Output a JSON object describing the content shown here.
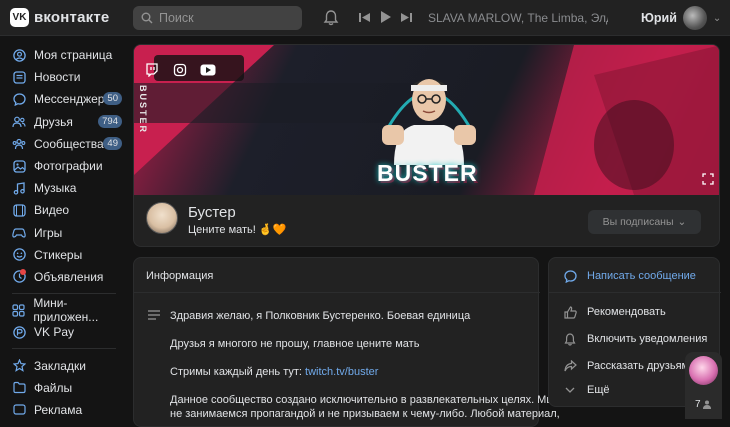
{
  "header": {
    "logo_mark": "VK",
    "logo_text": "вконтакте",
    "search_placeholder": "Поиск",
    "now_playing": "SLAVA MARLOW, The Limba, Элдже...",
    "user_name": "Юрий"
  },
  "sidebar": {
    "items": [
      {
        "label": "Моя страница",
        "icon": "user-circle-icon"
      },
      {
        "label": "Новости",
        "icon": "news-icon"
      },
      {
        "label": "Мессенджер",
        "icon": "messenger-icon",
        "badge": "50"
      },
      {
        "label": "Друзья",
        "icon": "friends-icon",
        "badge": "794"
      },
      {
        "label": "Сообщества",
        "icon": "communities-icon",
        "badge": "49"
      },
      {
        "label": "Фотографии",
        "icon": "photo-icon"
      },
      {
        "label": "Музыка",
        "icon": "music-icon"
      },
      {
        "label": "Видео",
        "icon": "video-icon"
      },
      {
        "label": "Игры",
        "icon": "games-icon"
      },
      {
        "label": "Стикеры",
        "icon": "stickers-icon"
      },
      {
        "label": "Объявления",
        "icon": "ads-icon"
      }
    ],
    "items2": [
      {
        "label": "Мини-приложен...",
        "icon": "mini-apps-icon"
      },
      {
        "label": "VK Pay",
        "icon": "vkpay-icon"
      }
    ],
    "items3": [
      {
        "label": "Закладки",
        "icon": "bookmarks-icon"
      },
      {
        "label": "Файлы",
        "icon": "files-icon"
      },
      {
        "label": "Реклама",
        "icon": "advert-icon"
      }
    ]
  },
  "cover": {
    "side_text": "BUSTER",
    "title": "BUSTER"
  },
  "page": {
    "name": "Бустер",
    "status": "Цените мать! 🤞🧡",
    "subscribe_label": "Вы подписаны"
  },
  "info": {
    "title": "Информация",
    "line1": "Здравия желаю, я Полковник Бустеренко. Боевая единица",
    "line2": "Друзья я многого не прошу, главное цените мать",
    "line3_prefix": "Стримы каждый день тут: ",
    "line3_link": "twitch.tv/buster",
    "line4": "Данное сообщество создано исключительно в развлекательных целях. Мы",
    "line5": "не занимаемся пропагандой и не призываем к чему-либо. Любой материал,"
  },
  "actions": {
    "message": "Написать сообщение",
    "recommend": "Рекомендовать",
    "notify": "Включить уведомления",
    "share": "Рассказать друзьям",
    "more": "Ещё"
  },
  "floater": {
    "count": "7"
  },
  "colors": {
    "accent": "#71aaeb",
    "bg": "#141414",
    "card": "#222222",
    "cover_pink": "#c61e4c",
    "neon": "#25d0d6"
  }
}
